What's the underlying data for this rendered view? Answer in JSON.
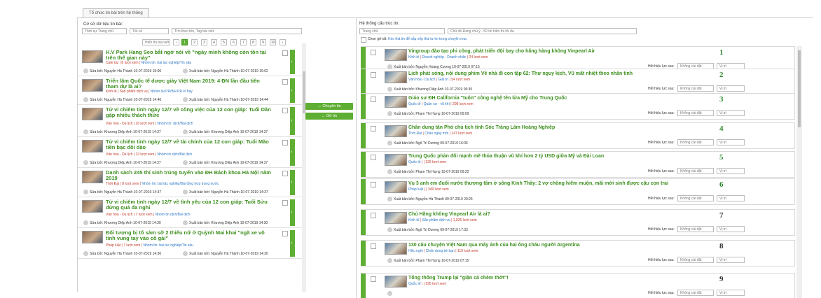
{
  "tab_label": "Tổ chức tin bài trên hệ thống",
  "left": {
    "source_label": "Cơ sở dữ liệu tin bài:",
    "filter_state": "Thời sự Trang chủ",
    "filter_all": "Tất cả",
    "search_placeholder": "Tìm theo tên, Tag bài viết",
    "pager_label": "Hiển thị bài viết",
    "pages": [
      "1",
      "2",
      "3",
      "4",
      "5",
      "6",
      "7",
      "8",
      "9",
      "10"
    ],
    "pager_prev": "‹",
    "pager_next": "›",
    "items": [
      {
        "title": "H.V Park Hang Seo bắt ngờ nói về \"ngày mình không còn tồn tại trên thế gian này\"",
        "meta": "Cafe biz",
        "views": "8 lượt xem",
        "link": "Nhóm tin: bài tác nghiệp/Tin sâu",
        "editor": "Sửa bởi: Nguyễn Hà Thành 10-07-2019 15:06",
        "pub": "Xuất bản bởi: Nguyễn Hà Thành 10-07-2019 15:02"
      },
      {
        "title": "Triển lãm Quốc tế dược giày Việt Nam 2019: 4 ĐN lần đầu tiên tham dự là ai?",
        "meta": "Kinh tế",
        "views": "Sản phẩm dịch vụ",
        "link": "Nhóm tài PR/Bài PR kì hay",
        "editor": "Sửa bởi: Nguyễn Hà Thành 10-07-2019 14:46",
        "pub": "Xuất bản bởi: Nguyễn Hà Thành 10-07-2019 14:44"
      },
      {
        "title": "Tử vi chiêm tinh ngày 12/7 về công việc của 12 con giáp: Tuổi Dần gặp nhiều thách thức",
        "meta": "Văn hóa - Du lịch",
        "views": "16 lượt xem",
        "link": "Nhóm tin: dịch/Bài dịch",
        "editor": "Sửa bởi: Khương Diệp Anh 10-07-2019 14:37",
        "pub": "Xuất bản bởi: Khương Diệp Anh 10-07-2019 14:37"
      },
      {
        "title": "Tử vi chiêm tinh ngày 12/7 về tài chính của 12 con giáp: Tuổi Mão tiền bạc dồi dào",
        "meta": "Văn hóa - Du lịch",
        "views": "13 lượt xem",
        "link": "Nhóm tin dịch/Bài dịch",
        "editor": "Sửa bởi: Khương Diệp Anh 10-07-2019 14:37",
        "pub": "Xuất bản bởi: Khương Diệp Anh 10-07-2019 14:37"
      },
      {
        "title": "Danh sách 245 thí sinh trúng tuyển vào ĐH Bách khoa Hà Nội năm 2019",
        "meta": "Thời Đại",
        "views": "8 lượt xem",
        "link": "Nhóm tin: bài tác nghiệp/Bài tổng hợp trong nước",
        "editor": "Sửa bởi: Nguyễn Hà Thành 10-07-2019 14:37",
        "pub": "Xuất bản bởi: Nguyễn Hà Thành 10-07-2019 14:37"
      },
      {
        "title": "Tử vi chiêm tinh ngày 12/7 về tình yêu của 12 con giáp: Tuổi Sửu đừng quá đa nghi",
        "meta": "Văn hóa - Du lịch",
        "views": "7 lượt xem",
        "link": "Nhóm tin dịch/Bài dịch",
        "editor": "Sửa bởi: Khương Diệp Anh 10-07-2019 14:30",
        "pub": "Xuất bản bởi: Khương Diệp Anh 10-07-2019 14:30"
      },
      {
        "title": "Đối tượng bị tố sàm sỡ 2 thiếu nữ ở Quỳnh Mai khai \"ngã xe vô tình vung tay vào cô gái\"",
        "meta": "Pháp luật",
        "views": "7 lượt xem",
        "link": "Nhóm tin: bài tác nghiệp/Tin sâu",
        "editor": "Sửa bởi: Nguyễn Hà Thành 10-07-2019 14:30",
        "pub": "Xuất bản bởi: Nguyễn Hà Thành 10-07-2019 14:30"
      }
    ]
  },
  "mid": {
    "move_label": "Chuyển tin",
    "remove_label": "Gỡ tin"
  },
  "right": {
    "system_label": "Hệ thống cấu trúc tin:",
    "position_select": "Trang chủ",
    "subcat_select": "Chủ đề Đang chú ý - 50 tin hiển thị tối đa",
    "hint_label": "Chọn gỡ tất:",
    "hint_text": "Kéo thả tin để sắp xếp thứ tự tin trong chuyên mục",
    "effect_label": "Hết hiệu lực sau:",
    "effect_value": "Không cài đặt",
    "pos_value": "Vị trí",
    "items": [
      {
        "no": "1",
        "title": "Vingroup đào tạo phi công, phát triển đội bay cho hãng hàng không Vinpearl Air",
        "cat": "Kinh tế",
        "cat2": "Doanh nghiệp - Doanh nhân",
        "views": "24 lượt xem",
        "pub": "Xuất bản bởi: Nguyễn Hoàng Cương 10-07-2019 07:15"
      },
      {
        "no": "2",
        "title": "Lịch phát sóng, nội dung phim Về nhà đi con tập 62: Thư nguy kịch, Vũ mất nhiệt theo nhân tình",
        "cat": "Văn hóa - Du lịch",
        "cat2": "Giải trí",
        "views": "54 lượt xem",
        "pub": "Xuất bản bởi: Khương Diệp Anh 10-07-2019 06:35"
      },
      {
        "no": "3",
        "title": "Giáo sư ĐH California \"tuôn\" công nghệ tên lửa Mỹ cho Trung Quốc",
        "cat": "Quốc tế",
        "cat2": "Quân sự - vũ khí",
        "views": "208 lượt xem",
        "pub": "Xuất bản bởi: Phạm Thị Hưng 10-07-2019 09:09"
      },
      {
        "no": "4",
        "title": "Chân dung tân Phó chủ tịch tỉnh Sóc Trăng Lâm Hoàng Nghiệp",
        "cat": "Thời Đại",
        "cat2": "Chào ngày mới",
        "views": "147 lượt xem",
        "pub": "Xuất bản bởi: Ngô Trí Dương 09-07-2019 16:06"
      },
      {
        "no": "5",
        "title": "Trung Quốc phản đối mạnh mẽ thỏa thuận vũ khí hơn 2 tỷ USD giữa Mỹ và Đài Loan",
        "cat": "Quốc tế",
        "cat2": "",
        "views": "125 lượt xem",
        "pub": "Xuất bản bởi: Phạm Thị Hưng 10-07-2019 09:22"
      },
      {
        "no": "6",
        "title": "Vụ 3 anh em đuối nước thương tâm ở sông Kinh Thầy: 2 vợ chồng hiếm muộn, mãi mới sinh được cậu con trai",
        "cat": "Pháp luật",
        "cat2": "",
        "views": "349 lượt xem",
        "pub": "Xuất bản bởi: Nguyễn Hà Thành 09-07-2019 20:26"
      },
      {
        "no": "7",
        "title": "Chủ Hãng không Vinpearl Air là ai?",
        "cat": "Kinh tế",
        "cat2": "Sản phẩm dịch vụ",
        "views": "1,025 lượt xem",
        "pub": "Xuất bản bởi: Ngô Trí Dương 09-07-2019 17:33"
      },
      {
        "no": "8",
        "title": "130 câu chuyện Việt Nam qua máy ảnh của hai ông cháu người Argentina",
        "cat": "Hữu nghị",
        "cat2": "Chân dung bè bạn",
        "views": "119 lượt xem",
        "pub": "Xuất bản bởi: Phạm Thị Hưng 10-07-2019 07:15"
      },
      {
        "no": "9",
        "title": "Tổng thống Trump lại \"giận cá chém thớt\"!",
        "cat": "Quốc tế",
        "cat2": "",
        "views": "195 lượt xem",
        "pub": ""
      }
    ]
  }
}
